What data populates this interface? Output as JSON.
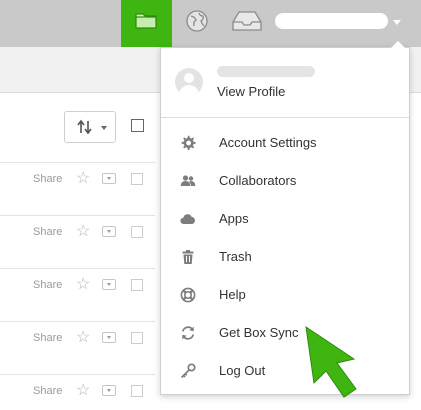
{
  "topbar": {
    "folder_icon": "folder-icon",
    "globe_icon": "globe-icon",
    "inbox_icon": "inbox-icon",
    "accent_color": "#3fb512"
  },
  "background": {
    "rows": [
      {
        "share": "Share"
      },
      {
        "share": "Share"
      },
      {
        "share": "Share"
      },
      {
        "share": "Share"
      },
      {
        "share": "Share"
      }
    ]
  },
  "dropdown": {
    "profile": {
      "view_profile_label": "View Profile"
    },
    "items": [
      {
        "label": "Account Settings",
        "icon": "gear-icon"
      },
      {
        "label": "Collaborators",
        "icon": "collaborators-icon"
      },
      {
        "label": "Apps",
        "icon": "cloud-icon"
      },
      {
        "label": "Trash",
        "icon": "trash-icon"
      },
      {
        "label": "Help",
        "icon": "lifebuoy-icon"
      },
      {
        "label": "Get Box Sync",
        "icon": "sync-icon"
      },
      {
        "label": "Log Out",
        "icon": "key-icon"
      }
    ]
  },
  "cursor": {
    "icon": "pointer-arrow-icon",
    "color": "#3fb512"
  }
}
